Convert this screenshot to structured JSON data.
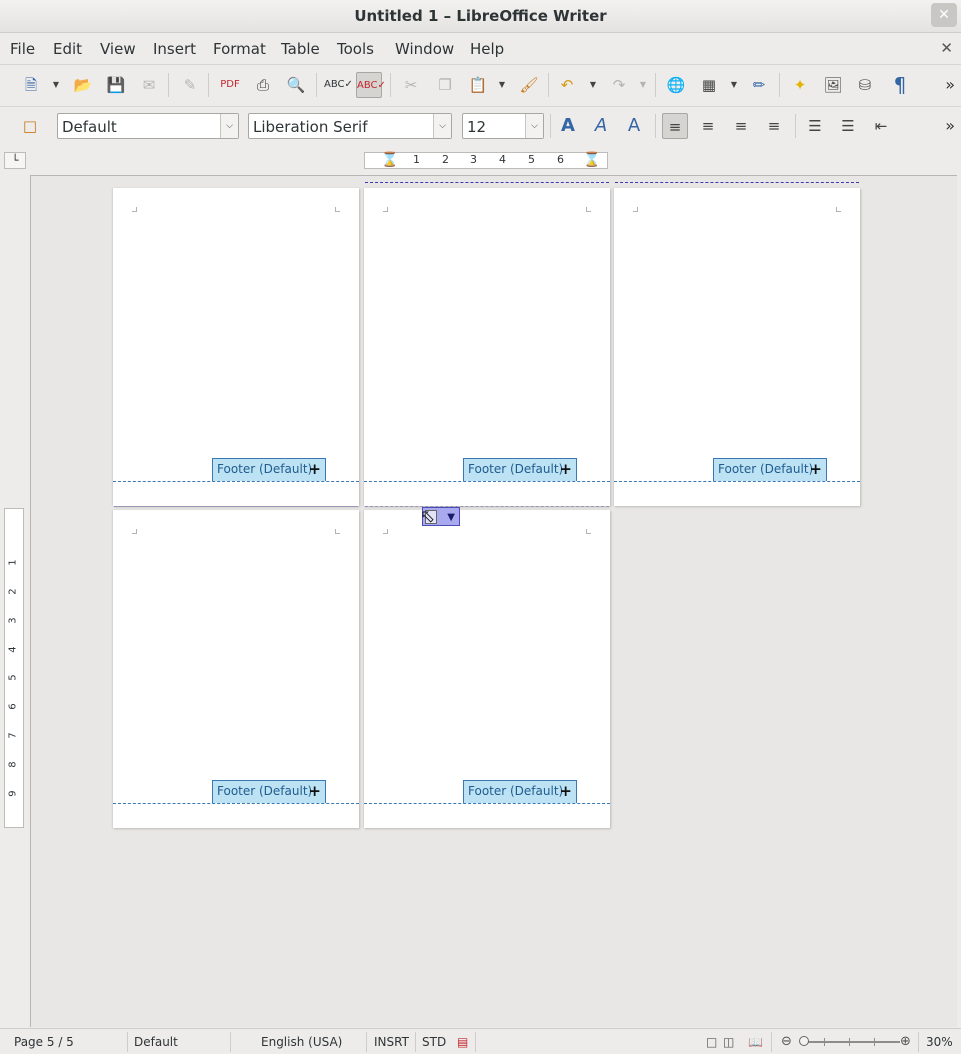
{
  "window": {
    "title": "Untitled 1 – LibreOffice Writer",
    "close_glyph": "✕"
  },
  "menubar": {
    "items": [
      "File",
      "Edit",
      "View",
      "Insert",
      "Format",
      "Table",
      "Tools",
      "Window",
      "Help"
    ],
    "doc_close_glyph": "✕"
  },
  "toolbar_standard": {
    "icons": [
      "new-document-icon",
      "open-folder-icon",
      "save-icon",
      "email-icon",
      "edit-file-icon",
      "export-pdf-icon",
      "print-icon",
      "print-preview-icon",
      "spellcheck-icon",
      "autospellcheck-icon",
      "cut-icon",
      "copy-icon",
      "paste-icon",
      "clone-formatting-icon",
      "undo-icon",
      "redo-icon",
      "hyperlink-icon",
      "table-icon",
      "show-draw-functions-icon",
      "navigator-icon",
      "gallery-icon",
      "data-sources-icon",
      "formatting-marks-icon"
    ],
    "overflow_glyph": "»"
  },
  "toolbar_formatting": {
    "paragraph_style": "Default",
    "font_name": "Liberation Serif",
    "font_size": "12",
    "overflow_glyph": "»"
  },
  "ruler": {
    "corner_glyph": "└",
    "h_numbers": [
      "1",
      "2",
      "3",
      "4",
      "5",
      "6"
    ],
    "v_numbers": [
      "1",
      "2",
      "3",
      "4",
      "5",
      "6",
      "7",
      "8",
      "9"
    ]
  },
  "pages": {
    "footer_label": "Footer (Default)",
    "footer_add_glyph": "+"
  },
  "statusbar": {
    "page": "Page 5 / 5",
    "page_style": "Default",
    "language": "English (USA)",
    "insert_mode": "INSRT",
    "selection_mode": "STD",
    "zoom": "30%",
    "zoom_out_glyph": "⊖",
    "zoom_in_glyph": "⊕"
  }
}
